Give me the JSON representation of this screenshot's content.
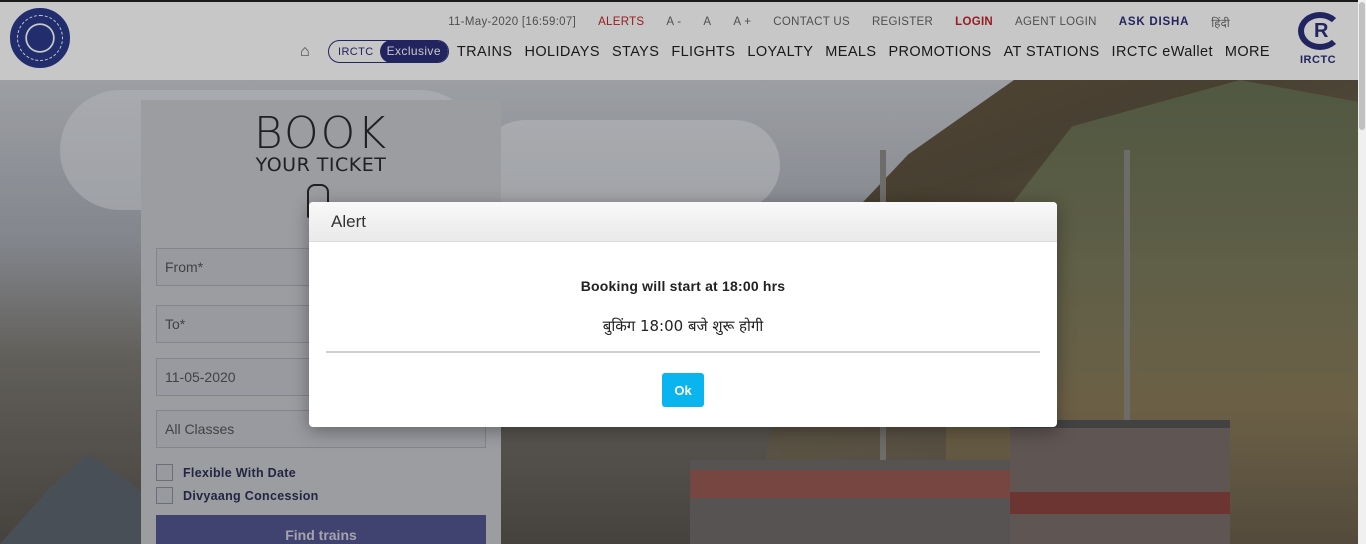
{
  "header": {
    "datetime": "11-May-2020 [16:59:07]",
    "alerts": "ALERTS",
    "font_small": "A -",
    "font_normal": "A",
    "font_large": "A +",
    "contact": "CONTACT US",
    "register": "REGISTER",
    "login": "LOGIN",
    "agent_login": "AGENT LOGIN",
    "ask_disha": "ASK DISHA",
    "hindi": "हिंदी",
    "exclusive_a": "IRCTC",
    "exclusive_b": "Exclusive",
    "nav": [
      "TRAINS",
      "HOLIDAYS",
      "STAYS",
      "FLIGHTS",
      "LOYALTY",
      "MEALS",
      "PROMOTIONS",
      "AT STATIONS",
      "IRCTC eWallet",
      "MORE"
    ],
    "brand": "IRCTC"
  },
  "booking": {
    "title": "BOOK",
    "subtitle": "YOUR TICKET",
    "from_placeholder": "From*",
    "to_placeholder": "To*",
    "date_value": "11-05-2020",
    "class_value": "All Classes",
    "flexible": "Flexible With Date",
    "divyaang": "Divyaang Concession",
    "find": "Find trains"
  },
  "modal": {
    "title": "Alert",
    "message_en": "Booking will start at 18:00 hrs",
    "message_hi": "बुकिंग 18:00 बजे शुरू होगी",
    "ok": "Ok",
    "ok_color": "#0ab4ee"
  }
}
